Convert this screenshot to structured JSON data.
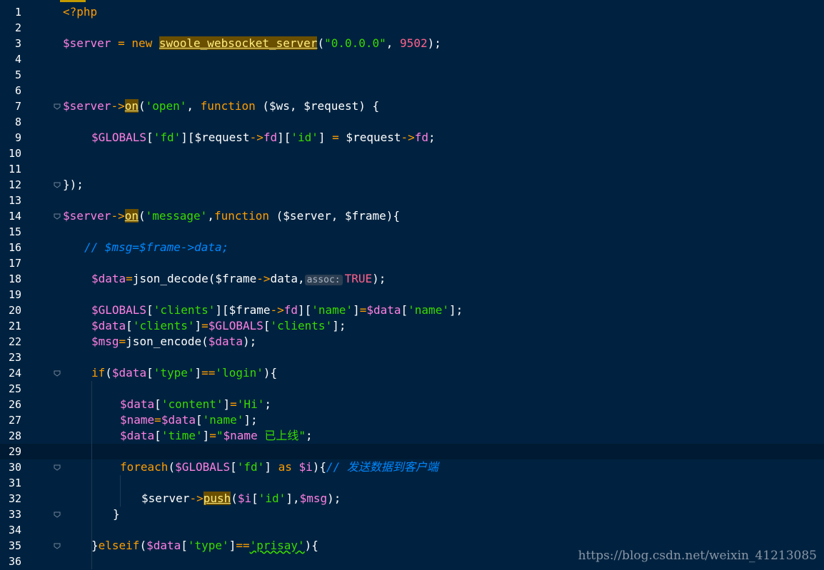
{
  "editor": {
    "watermark": "https://blog.csdn.net/weixin_41213085",
    "current_line": 29,
    "lines": [
      {
        "n": "1",
        "fold": false,
        "tokens": [
          {
            "c": "t-kw",
            "t": "<?php"
          }
        ]
      },
      {
        "n": "2",
        "fold": false,
        "tokens": []
      },
      {
        "n": "3",
        "fold": false,
        "tokens": [
          {
            "c": "t-var",
            "t": "$server"
          },
          {
            "c": "t-op",
            "t": " = "
          },
          {
            "c": "t-kw",
            "t": "new "
          },
          {
            "c": "t-hl",
            "t": "swoole_websocket_server"
          },
          {
            "c": "t-punct",
            "t": "("
          },
          {
            "c": "t-str",
            "t": "\"0.0.0.0\""
          },
          {
            "c": "t-punct",
            "t": ", "
          },
          {
            "c": "t-num",
            "t": "9502"
          },
          {
            "c": "t-punct",
            "t": ");"
          }
        ]
      },
      {
        "n": "4",
        "fold": false,
        "tokens": []
      },
      {
        "n": "5",
        "fold": false,
        "tokens": []
      },
      {
        "n": "6",
        "fold": false,
        "tokens": []
      },
      {
        "n": "7",
        "fold": true,
        "tokens": [
          {
            "c": "t-var",
            "t": "$server"
          },
          {
            "c": "t-op",
            "t": "->"
          },
          {
            "c": "t-hl",
            "t": "on"
          },
          {
            "c": "t-punct",
            "t": "("
          },
          {
            "c": "t-str",
            "t": "'open'"
          },
          {
            "c": "t-punct",
            "t": ", "
          },
          {
            "c": "t-kw",
            "t": "function "
          },
          {
            "c": "t-punct",
            "t": "("
          },
          {
            "c": "t-plain",
            "t": "$ws"
          },
          {
            "c": "t-punct",
            "t": ", "
          },
          {
            "c": "t-plain",
            "t": "$request"
          },
          {
            "c": "t-punct",
            "t": ") {"
          }
        ]
      },
      {
        "n": "8",
        "fold": false,
        "tokens": []
      },
      {
        "n": "9",
        "fold": false,
        "indent": 4,
        "tokens": [
          {
            "c": "t-var",
            "t": "$GLOBALS"
          },
          {
            "c": "t-punct",
            "t": "["
          },
          {
            "c": "t-str",
            "t": "'fd'"
          },
          {
            "c": "t-punct",
            "t": "]["
          },
          {
            "c": "t-plain",
            "t": "$request"
          },
          {
            "c": "t-op",
            "t": "->"
          },
          {
            "c": "t-var",
            "t": "fd"
          },
          {
            "c": "t-punct",
            "t": "]["
          },
          {
            "c": "t-str",
            "t": "'id'"
          },
          {
            "c": "t-punct",
            "t": "] "
          },
          {
            "c": "t-op",
            "t": "="
          },
          {
            "c": "t-plain",
            "t": " $request"
          },
          {
            "c": "t-op",
            "t": "->"
          },
          {
            "c": "t-var",
            "t": "fd"
          },
          {
            "c": "t-punct",
            "t": ";"
          }
        ]
      },
      {
        "n": "10",
        "fold": false,
        "tokens": []
      },
      {
        "n": "11",
        "fold": false,
        "tokens": []
      },
      {
        "n": "12",
        "fold": true,
        "tokens": [
          {
            "c": "t-punct",
            "t": "});"
          }
        ]
      },
      {
        "n": "13",
        "fold": false,
        "tokens": []
      },
      {
        "n": "14",
        "fold": true,
        "tokens": [
          {
            "c": "t-var",
            "t": "$server"
          },
          {
            "c": "t-op",
            "t": "->"
          },
          {
            "c": "t-hl",
            "t": "on"
          },
          {
            "c": "t-punct",
            "t": "("
          },
          {
            "c": "t-str",
            "t": "'message'"
          },
          {
            "c": "t-punct",
            "t": ","
          },
          {
            "c": "t-kw",
            "t": "function "
          },
          {
            "c": "t-punct",
            "t": "("
          },
          {
            "c": "t-plain",
            "t": "$server"
          },
          {
            "c": "t-punct",
            "t": ", "
          },
          {
            "c": "t-plain",
            "t": "$frame"
          },
          {
            "c": "t-punct",
            "t": "){"
          }
        ]
      },
      {
        "n": "15",
        "fold": false,
        "tokens": []
      },
      {
        "n": "16",
        "fold": false,
        "indent": 3,
        "tokens": [
          {
            "c": "t-comment",
            "t": "// $msg=$frame->data;"
          }
        ]
      },
      {
        "n": "17",
        "fold": false,
        "tokens": []
      },
      {
        "n": "18",
        "fold": false,
        "indent": 4,
        "tokens": [
          {
            "c": "t-var",
            "t": "$data"
          },
          {
            "c": "t-op",
            "t": "="
          },
          {
            "c": "t-plain",
            "t": "json_decode"
          },
          {
            "c": "t-punct",
            "t": "("
          },
          {
            "c": "t-plain",
            "t": "$frame"
          },
          {
            "c": "t-op",
            "t": "->"
          },
          {
            "c": "t-plain",
            "t": "data"
          },
          {
            "c": "t-punct",
            "t": ","
          },
          {
            "c": "t-hint",
            "t": "assoc:"
          },
          {
            "c": "t-const",
            "t": "TRUE"
          },
          {
            "c": "t-punct",
            "t": ");"
          }
        ]
      },
      {
        "n": "19",
        "fold": false,
        "tokens": []
      },
      {
        "n": "20",
        "fold": false,
        "indent": 4,
        "tokens": [
          {
            "c": "t-var",
            "t": "$GLOBALS"
          },
          {
            "c": "t-punct",
            "t": "["
          },
          {
            "c": "t-str",
            "t": "'clients'"
          },
          {
            "c": "t-punct",
            "t": "]["
          },
          {
            "c": "t-plain",
            "t": "$frame"
          },
          {
            "c": "t-op",
            "t": "->"
          },
          {
            "c": "t-var",
            "t": "fd"
          },
          {
            "c": "t-punct",
            "t": "]["
          },
          {
            "c": "t-str",
            "t": "'name'"
          },
          {
            "c": "t-punct",
            "t": "]"
          },
          {
            "c": "t-op",
            "t": "="
          },
          {
            "c": "t-var",
            "t": "$data"
          },
          {
            "c": "t-punct",
            "t": "["
          },
          {
            "c": "t-str",
            "t": "'name'"
          },
          {
            "c": "t-punct",
            "t": "];"
          }
        ]
      },
      {
        "n": "21",
        "fold": false,
        "indent": 4,
        "tokens": [
          {
            "c": "t-var",
            "t": "$data"
          },
          {
            "c": "t-punct",
            "t": "["
          },
          {
            "c": "t-str",
            "t": "'clients'"
          },
          {
            "c": "t-punct",
            "t": "]"
          },
          {
            "c": "t-op",
            "t": "="
          },
          {
            "c": "t-var",
            "t": "$GLOBALS"
          },
          {
            "c": "t-punct",
            "t": "["
          },
          {
            "c": "t-str",
            "t": "'clients'"
          },
          {
            "c": "t-punct",
            "t": "];"
          }
        ]
      },
      {
        "n": "22",
        "fold": false,
        "indent": 4,
        "tokens": [
          {
            "c": "t-var",
            "t": "$msg"
          },
          {
            "c": "t-op",
            "t": "="
          },
          {
            "c": "t-plain",
            "t": "json_encode"
          },
          {
            "c": "t-punct",
            "t": "("
          },
          {
            "c": "t-var",
            "t": "$data"
          },
          {
            "c": "t-punct",
            "t": ");"
          }
        ]
      },
      {
        "n": "23",
        "fold": false,
        "tokens": []
      },
      {
        "n": "24",
        "fold": true,
        "indent": 4,
        "tokens": [
          {
            "c": "t-kw",
            "t": "if"
          },
          {
            "c": "t-punct",
            "t": "("
          },
          {
            "c": "t-var",
            "t": "$data"
          },
          {
            "c": "t-punct",
            "t": "["
          },
          {
            "c": "t-str",
            "t": "'type'"
          },
          {
            "c": "t-punct",
            "t": "]"
          },
          {
            "c": "t-op",
            "t": "=="
          },
          {
            "c": "t-str",
            "t": "'login'"
          },
          {
            "c": "t-punct",
            "t": "){"
          }
        ]
      },
      {
        "n": "25",
        "fold": false,
        "tokens": []
      },
      {
        "n": "26",
        "fold": false,
        "indent": 8,
        "tokens": [
          {
            "c": "t-var",
            "t": "$data"
          },
          {
            "c": "t-punct",
            "t": "["
          },
          {
            "c": "t-str",
            "t": "'content'"
          },
          {
            "c": "t-punct",
            "t": "]"
          },
          {
            "c": "t-op",
            "t": "="
          },
          {
            "c": "t-str",
            "t": "'Hi'"
          },
          {
            "c": "t-punct",
            "t": ";"
          }
        ]
      },
      {
        "n": "27",
        "fold": false,
        "indent": 8,
        "tokens": [
          {
            "c": "t-var",
            "t": "$name"
          },
          {
            "c": "t-op",
            "t": "="
          },
          {
            "c": "t-var",
            "t": "$data"
          },
          {
            "c": "t-punct",
            "t": "["
          },
          {
            "c": "t-str",
            "t": "'name'"
          },
          {
            "c": "t-punct",
            "t": "];"
          }
        ]
      },
      {
        "n": "28",
        "fold": false,
        "indent": 8,
        "tokens": [
          {
            "c": "t-var",
            "t": "$data"
          },
          {
            "c": "t-punct",
            "t": "["
          },
          {
            "c": "t-str",
            "t": "'time'"
          },
          {
            "c": "t-punct",
            "t": "]"
          },
          {
            "c": "t-op",
            "t": "="
          },
          {
            "c": "t-str",
            "t": "\""
          },
          {
            "c": "t-var",
            "t": "$name"
          },
          {
            "c": "t-str",
            "t": " 已上线\""
          },
          {
            "c": "t-punct",
            "t": ";"
          }
        ]
      },
      {
        "n": "29",
        "fold": false,
        "tokens": []
      },
      {
        "n": "30",
        "fold": true,
        "indent": 8,
        "tokens": [
          {
            "c": "t-kw",
            "t": "foreach"
          },
          {
            "c": "t-punct",
            "t": "("
          },
          {
            "c": "t-var",
            "t": "$GLOBALS"
          },
          {
            "c": "t-punct",
            "t": "["
          },
          {
            "c": "t-str",
            "t": "'fd'"
          },
          {
            "c": "t-punct",
            "t": "] "
          },
          {
            "c": "t-kw",
            "t": "as "
          },
          {
            "c": "t-var",
            "t": "$i"
          },
          {
            "c": "t-punct",
            "t": "){"
          },
          {
            "c": "t-comment",
            "t": "// 发送数据到客户端"
          }
        ]
      },
      {
        "n": "31",
        "fold": false,
        "tokens": []
      },
      {
        "n": "32",
        "fold": false,
        "indent": 11,
        "tokens": [
          {
            "c": "t-plain",
            "t": "$server"
          },
          {
            "c": "t-op",
            "t": "->"
          },
          {
            "c": "t-hl",
            "t": "push"
          },
          {
            "c": "t-punct",
            "t": "("
          },
          {
            "c": "t-var",
            "t": "$i"
          },
          {
            "c": "t-punct",
            "t": "["
          },
          {
            "c": "t-str",
            "t": "'id'"
          },
          {
            "c": "t-punct",
            "t": "],"
          },
          {
            "c": "t-var",
            "t": "$msg"
          },
          {
            "c": "t-punct",
            "t": ");"
          }
        ]
      },
      {
        "n": "33",
        "fold": true,
        "indent": 7,
        "tokens": [
          {
            "c": "t-punct",
            "t": "}"
          }
        ]
      },
      {
        "n": "34",
        "fold": false,
        "tokens": []
      },
      {
        "n": "35",
        "fold": true,
        "indent": 4,
        "tokens": [
          {
            "c": "t-punct",
            "t": "}"
          },
          {
            "c": "t-kw",
            "t": "elseif"
          },
          {
            "c": "t-punct",
            "t": "("
          },
          {
            "c": "t-var",
            "t": "$data"
          },
          {
            "c": "t-punct",
            "t": "["
          },
          {
            "c": "t-str",
            "t": "'type'"
          },
          {
            "c": "t-punct",
            "t": "]"
          },
          {
            "c": "t-op",
            "t": "=="
          },
          {
            "c": "t-squig",
            "t": "'prisay'"
          },
          {
            "c": "t-punct",
            "t": "){"
          }
        ]
      },
      {
        "n": "36",
        "fold": false,
        "tokens": []
      }
    ]
  }
}
